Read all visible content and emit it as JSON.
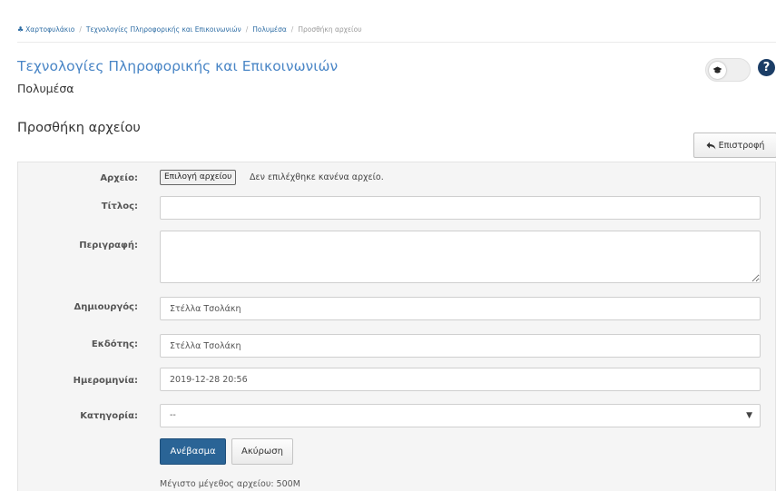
{
  "breadcrumb": {
    "items": [
      "Χαρτοφυλάκιο",
      "Τεχνολογίες Πληροφορικής και Επικοινωνιών",
      "Πολυμέσα",
      "Προσθήκη αρχείου"
    ],
    "separator": "/"
  },
  "course": {
    "title": "Τεχνολογίες Πληροφορικής και Επικοινωνιών",
    "subtitle": "Πολυμέσα"
  },
  "page": {
    "title": "Προσθήκη αρχείου",
    "back_label": "Επιστροφή"
  },
  "form": {
    "file": {
      "label": "Αρχείο:",
      "button_label": "Επιλογή αρχείου",
      "status": "Δεν επιλέχθηκε κανένα αρχείο."
    },
    "title": {
      "label": "Τίτλος:",
      "value": ""
    },
    "description": {
      "label": "Περιγραφή:",
      "value": ""
    },
    "creator": {
      "label": "Δημιουργός:",
      "value": "Στέλλα Τσολάκη"
    },
    "publisher": {
      "label": "Εκδότης:",
      "value": "Στέλλα Τσολάκη"
    },
    "date": {
      "label": "Ημερομηνία:",
      "value": "2019-12-28 20:56"
    },
    "category": {
      "label": "Κατηγορία:",
      "value": "--"
    },
    "upload_label": "Ανέβασμα",
    "cancel_label": "Ακύρωση",
    "max_size_note": "Μέγιστο μέγεθος αρχείου: 500M"
  },
  "colors": {
    "link": "#2e6da4",
    "course_title": "#4a86c6",
    "primary_button": "#2a6496",
    "help_icon": "#1b3d66"
  },
  "icons": {
    "home": "home-icon",
    "reply": "reply-icon",
    "graduation_cap": "graduation-cap-icon",
    "help": "question-circle-icon",
    "caret": "caret-down-icon"
  }
}
